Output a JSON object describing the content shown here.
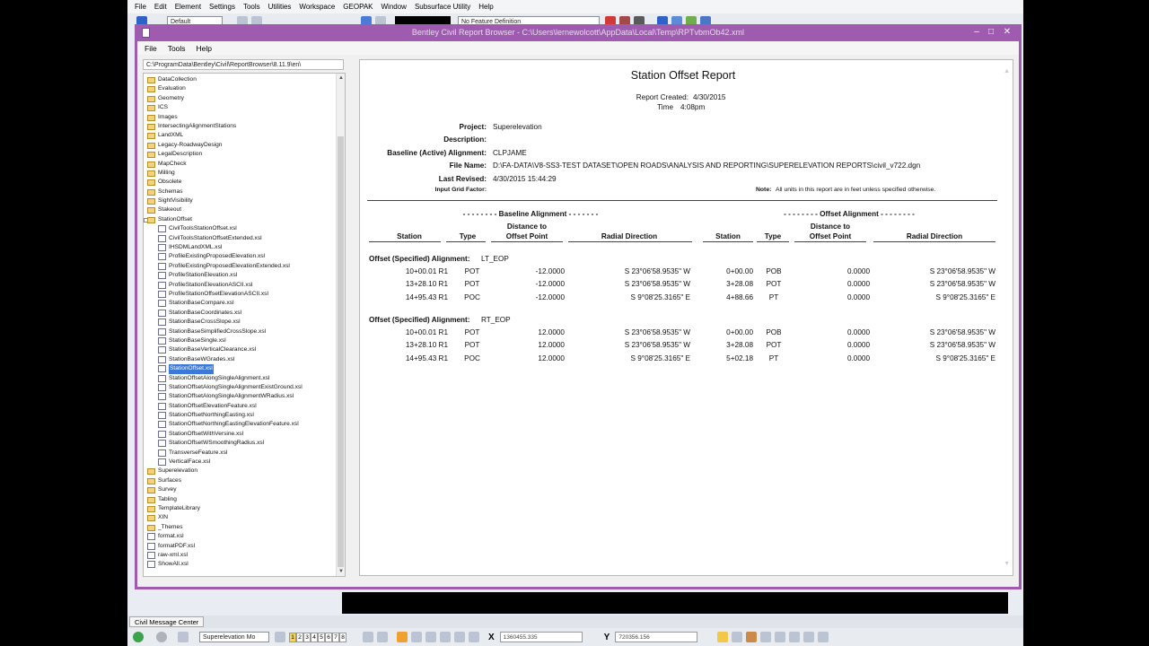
{
  "host": {
    "menu": [
      "File",
      "Edit",
      "Element",
      "Settings",
      "Tools",
      "Utilities",
      "Workspace",
      "GEOPAK",
      "Window",
      "Subsurface Utility",
      "Help"
    ],
    "level_combo": "Default",
    "feature_combo": "No Feature Definition"
  },
  "window": {
    "title": "Bentley Civil Report Browser - C:\\Users\\lernewolcott\\AppData\\Local\\Temp\\RPTvbmOb42.xml",
    "menu": [
      "File",
      "Tools",
      "Help"
    ]
  },
  "left_pane": {
    "path": "C:\\ProgramData\\Bentley\\Civil\\ReportBrowser\\8.11.9\\en\\",
    "tree": [
      {
        "label": "DataCollection",
        "kind": "folder",
        "level": 0
      },
      {
        "label": "Evaluation",
        "kind": "folder",
        "level": 0
      },
      {
        "label": "Geometry",
        "kind": "folder",
        "level": 0
      },
      {
        "label": "ICS",
        "kind": "folder",
        "level": 0
      },
      {
        "label": "Images",
        "kind": "folder",
        "level": 0
      },
      {
        "label": "IntersectingAlignmentStations",
        "kind": "folder",
        "level": 0
      },
      {
        "label": "LandXML",
        "kind": "folder",
        "level": 0
      },
      {
        "label": "Legacy-RoadwayDesign",
        "kind": "folder",
        "level": 0
      },
      {
        "label": "LegalDescription",
        "kind": "folder",
        "level": 0
      },
      {
        "label": "MapCheck",
        "kind": "folder",
        "level": 0
      },
      {
        "label": "Milling",
        "kind": "folder",
        "level": 0
      },
      {
        "label": "Obsolete",
        "kind": "folder",
        "level": 0
      },
      {
        "label": "Schemas",
        "kind": "folder",
        "level": 0
      },
      {
        "label": "SightVisibility",
        "kind": "folder",
        "level": 0
      },
      {
        "label": "Stakeout",
        "kind": "folder",
        "level": 0
      },
      {
        "label": "StationOffset",
        "kind": "folder",
        "level": 0,
        "expanded": true
      },
      {
        "label": "CivilToolsStationOffset.xsl",
        "kind": "file",
        "level": 1
      },
      {
        "label": "CivilToolsStationOffsetExtended.xsl",
        "kind": "file",
        "level": 1
      },
      {
        "label": "IHSDMLandXML.xsl",
        "kind": "file",
        "level": 1
      },
      {
        "label": "ProfileExistingProposedElevation.xsl",
        "kind": "file",
        "level": 1
      },
      {
        "label": "ProfileExistingProposedElevationExtended.xsl",
        "kind": "file",
        "level": 1
      },
      {
        "label": "ProfileStationElevation.xsl",
        "kind": "file",
        "level": 1
      },
      {
        "label": "ProfileStationElevationASCII.xsl",
        "kind": "file",
        "level": 1
      },
      {
        "label": "ProfileStationOffsetElevationASCII.xsl",
        "kind": "file",
        "level": 1
      },
      {
        "label": "StationBaseCompare.xsl",
        "kind": "file",
        "level": 1
      },
      {
        "label": "StationBaseCoordinates.xsl",
        "kind": "file",
        "level": 1
      },
      {
        "label": "StationBaseCrossSlope.xsl",
        "kind": "file",
        "level": 1
      },
      {
        "label": "StationBaseSimplifiedCrossSlope.xsl",
        "kind": "file",
        "level": 1
      },
      {
        "label": "StationBaseSingle.xsl",
        "kind": "file",
        "level": 1
      },
      {
        "label": "StationBaseVerticalClearance.xsl",
        "kind": "file",
        "level": 1
      },
      {
        "label": "StationBaseWGrades.xsl",
        "kind": "file",
        "level": 1
      },
      {
        "label": "StationOffset.xsl",
        "kind": "file",
        "level": 1,
        "selected": true
      },
      {
        "label": "StationOffsetAlongSingleAlignment.xsl",
        "kind": "file",
        "level": 1
      },
      {
        "label": "StationOffsetAlongSingleAlignmentExistGround.xsl",
        "kind": "file",
        "level": 1
      },
      {
        "label": "StationOffsetAlongSingleAlignmentWRadius.xsl",
        "kind": "file",
        "level": 1
      },
      {
        "label": "StationOffsetElevationFeature.xsl",
        "kind": "file",
        "level": 1
      },
      {
        "label": "StationOffsetNorthingEasting.xsl",
        "kind": "file",
        "level": 1
      },
      {
        "label": "StationOffsetNorthingEastingElevationFeature.xsl",
        "kind": "file",
        "level": 1
      },
      {
        "label": "StationOffsetWithVersine.xsl",
        "kind": "file",
        "level": 1
      },
      {
        "label": "StationOffsetWSmoothingRadius.xsl",
        "kind": "file",
        "level": 1
      },
      {
        "label": "TransverseFeature.xsl",
        "kind": "file",
        "level": 1
      },
      {
        "label": "VerticalFace.xsl",
        "kind": "file",
        "level": 1
      },
      {
        "label": "Superelevation",
        "kind": "folder",
        "level": 0
      },
      {
        "label": "Surfaces",
        "kind": "folder",
        "level": 0
      },
      {
        "label": "Survey",
        "kind": "folder",
        "level": 0
      },
      {
        "label": "Tabling",
        "kind": "folder",
        "level": 0
      },
      {
        "label": "TemplateLibrary",
        "kind": "folder",
        "level": 0
      },
      {
        "label": "XIN",
        "kind": "folder",
        "level": 0
      },
      {
        "label": "_Themes",
        "kind": "folder",
        "level": 0
      },
      {
        "label": "format.xsl",
        "kind": "file",
        "level": 0
      },
      {
        "label": "formatPDF.xsl",
        "kind": "file",
        "level": 0
      },
      {
        "label": "raw-xml.xsl",
        "kind": "file",
        "level": 0
      },
      {
        "label": "ShowAll.xsl",
        "kind": "file",
        "level": 0
      }
    ]
  },
  "report": {
    "title": "Station Offset Report",
    "created_label": "Report Created:",
    "created_value": "4/30/2015",
    "time_label": "Time",
    "time_value": "4:08pm",
    "meta": [
      {
        "label": "Project:",
        "value": "Superelevation"
      },
      {
        "label": "Description:",
        "value": ""
      },
      {
        "label": "Baseline (Active) Alignment:",
        "value": "CLPJAME"
      },
      {
        "label": "File Name:",
        "value": "D:\\FA-DATA\\V8-SS3-TEST DATASET\\OPEN ROADS\\ANALYSIS AND REPORTING\\SUPERELEVATION REPORTS\\civil_v722.dgn"
      },
      {
        "label": "Last Revised:",
        "value": "4/30/2015 15:44:29"
      }
    ],
    "grid_factor_label": "Input Grid Factor:",
    "note_label": "Note:",
    "note_text": "All units in this report are in feet unless specified otherwise.",
    "baseline_group": "- - - - - - - - Baseline Alignment - - - - - - -",
    "offset_group": "- - - - - - - - Offset Alignment - - - - - - - -",
    "columns": {
      "station": "Station",
      "type": "Type",
      "dist_1": "Distance to",
      "dist_2": "Offset Point",
      "radial": "Radial Direction",
      "station2": "Station",
      "type2": "Type",
      "dist2_1": "Distance to",
      "dist2_2": "Offset Point",
      "radial2": "Radial Direction"
    },
    "sections": [
      {
        "label": "Offset (Specified) Alignment:",
        "name": "LT_EOP",
        "rows": [
          [
            "10+00.01 R1",
            "POT",
            "-12.0000",
            "S 23°06'58.9535\" W",
            "0+00.00",
            "POB",
            "0.0000",
            "S 23°06'58.9535\" W"
          ],
          [
            "13+28.10 R1",
            "POT",
            "-12.0000",
            "S 23°06'58.9535\" W",
            "3+28.08",
            "POT",
            "0.0000",
            "S 23°06'58.9535\" W"
          ],
          [
            "14+95.43 R1",
            "POC",
            "-12.0000",
            "S 9°08'25.3165\" E",
            "4+88.66",
            "PT",
            "0.0000",
            "S 9°08'25.3165\" E"
          ]
        ]
      },
      {
        "label": "Offset (Specified) Alignment:",
        "name": "RT_EOP",
        "rows": [
          [
            "10+00.01 R1",
            "POT",
            "12.0000",
            "S 23°06'58.9535\" W",
            "0+00.00",
            "POB",
            "0.0000",
            "S 23°06'58.9535\" W"
          ],
          [
            "13+28.10 R1",
            "POT",
            "12.0000",
            "S 23°06'58.9535\" W",
            "3+28.08",
            "POT",
            "0.0000",
            "S 23°06'58.9535\" W"
          ],
          [
            "14+95.43 R1",
            "POC",
            "12.0000",
            "S 9°08'25.3165\" E",
            "5+02.18",
            "PT",
            "0.0000",
            "S 9°08'25.3165\" E"
          ]
        ]
      }
    ]
  },
  "bottom": {
    "message_center_tab": "Civil Message Center",
    "model_combo": "Superelevation Mo",
    "view_numbers": [
      "1",
      "2",
      "3",
      "4",
      "5",
      "6",
      "7",
      "8"
    ],
    "x_label": "X",
    "x_value": "1360455.335",
    "y_label": "Y",
    "y_value": "720356.156"
  },
  "colors": {
    "window_frame": "#9f5bb0",
    "selection": "#3b79d8",
    "folder": "#f4d27e"
  }
}
